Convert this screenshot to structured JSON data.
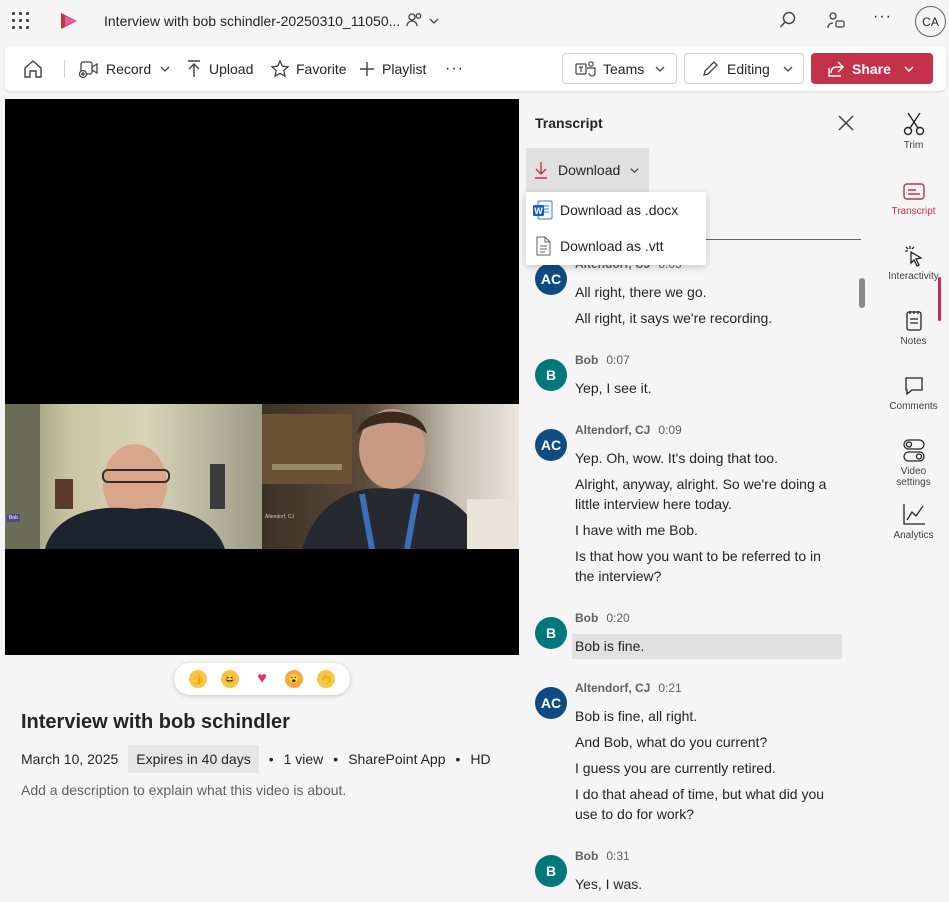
{
  "header": {
    "title": "Interview with bob schindler-20250310_11050...",
    "avatar_initials": "CA"
  },
  "toolbar": {
    "record": "Record",
    "upload": "Upload",
    "favorite": "Favorite",
    "playlist": "Playlist",
    "teams": "Teams",
    "editing": "Editing",
    "share": "Share"
  },
  "video": {
    "label_left": "Bob",
    "label_right": "Altendorf, CJ",
    "title": "Interview with bob schindler",
    "date": "March 10, 2025",
    "expires": "Expires in 40 days",
    "views": "1 view",
    "source": "SharePoint App",
    "quality": "HD",
    "description_placeholder": "Add a description to explain what this video is about."
  },
  "transcript": {
    "title": "Transcript",
    "download_label": "Download",
    "menu": [
      "Download as .docx",
      "Download as .vtt"
    ],
    "entries": [
      {
        "initials": "AC",
        "speaker": "Altendorf, CJ",
        "time": "0:05",
        "lines": [
          "All right, there we go.",
          "All right, it says we're recording."
        ]
      },
      {
        "initials": "B",
        "speaker": "Bob",
        "time": "0:07",
        "lines": [
          "Yep, I see it."
        ]
      },
      {
        "initials": "AC",
        "speaker": "Altendorf, CJ",
        "time": "0:09",
        "lines": [
          "Yep. Oh, wow. It's doing that too.",
          "Alright, anyway, alright. So we're doing a little interview here today.",
          "I have with me Bob.",
          "Is that how you want to be referred to in the interview?"
        ]
      },
      {
        "initials": "B",
        "speaker": "Bob",
        "time": "0:20",
        "lines": [
          "Bob is fine."
        ]
      },
      {
        "initials": "AC",
        "speaker": "Altendorf, CJ",
        "time": "0:21",
        "lines": [
          "Bob is fine, all right.",
          "And Bob, what do you current?",
          "I guess you are currently retired.",
          "I do that ahead of time, but what did you use to do for work?"
        ]
      },
      {
        "initials": "B",
        "speaker": "Bob",
        "time": "0:31",
        "lines": [
          "Yes, I was."
        ]
      }
    ]
  },
  "rail": {
    "trim": "Trim",
    "transcript": "Transcript",
    "interactivity": "Interactivity",
    "notes": "Notes",
    "comments": "Comments",
    "video_settings_1": "Video",
    "video_settings_2": "settings",
    "analytics": "Analytics"
  },
  "colors": {
    "accent": "#c4314b",
    "ac_avatar": "#0f4c81",
    "b_avatar": "#03787c"
  }
}
